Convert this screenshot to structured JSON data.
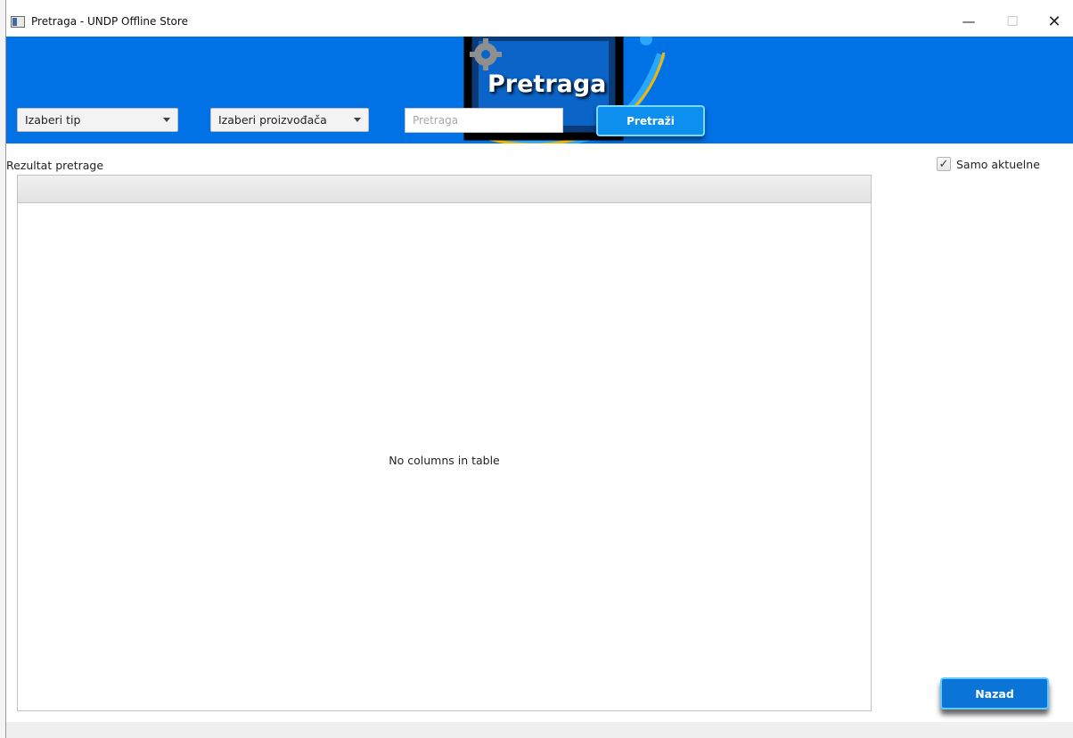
{
  "window": {
    "title": "Pretraga - UNDP Offline Store",
    "minimize_glyph": "—",
    "maximize_glyph": "☐",
    "close_glyph": "✕"
  },
  "banner": {
    "title": "Pretraga",
    "background_color": "#0072e5"
  },
  "filters": {
    "type_selected": "Izaberi tip",
    "manufacturer_selected": "Izaberi proizvođača",
    "search_placeholder": "Pretraga",
    "search_value": "",
    "search_button_label": "Pretraži"
  },
  "results": {
    "label": "Rezultat pretrage",
    "empty_message": "No columns in table"
  },
  "options": {
    "only_current_label": "Samo aktuelne",
    "only_current_checked": true,
    "check_glyph": "✓"
  },
  "footer": {
    "back_button_label": "Nazad"
  },
  "icons": [
    "app-window-icon",
    "gear-icon",
    "caret-down-icon",
    "checkmark-icon"
  ]
}
